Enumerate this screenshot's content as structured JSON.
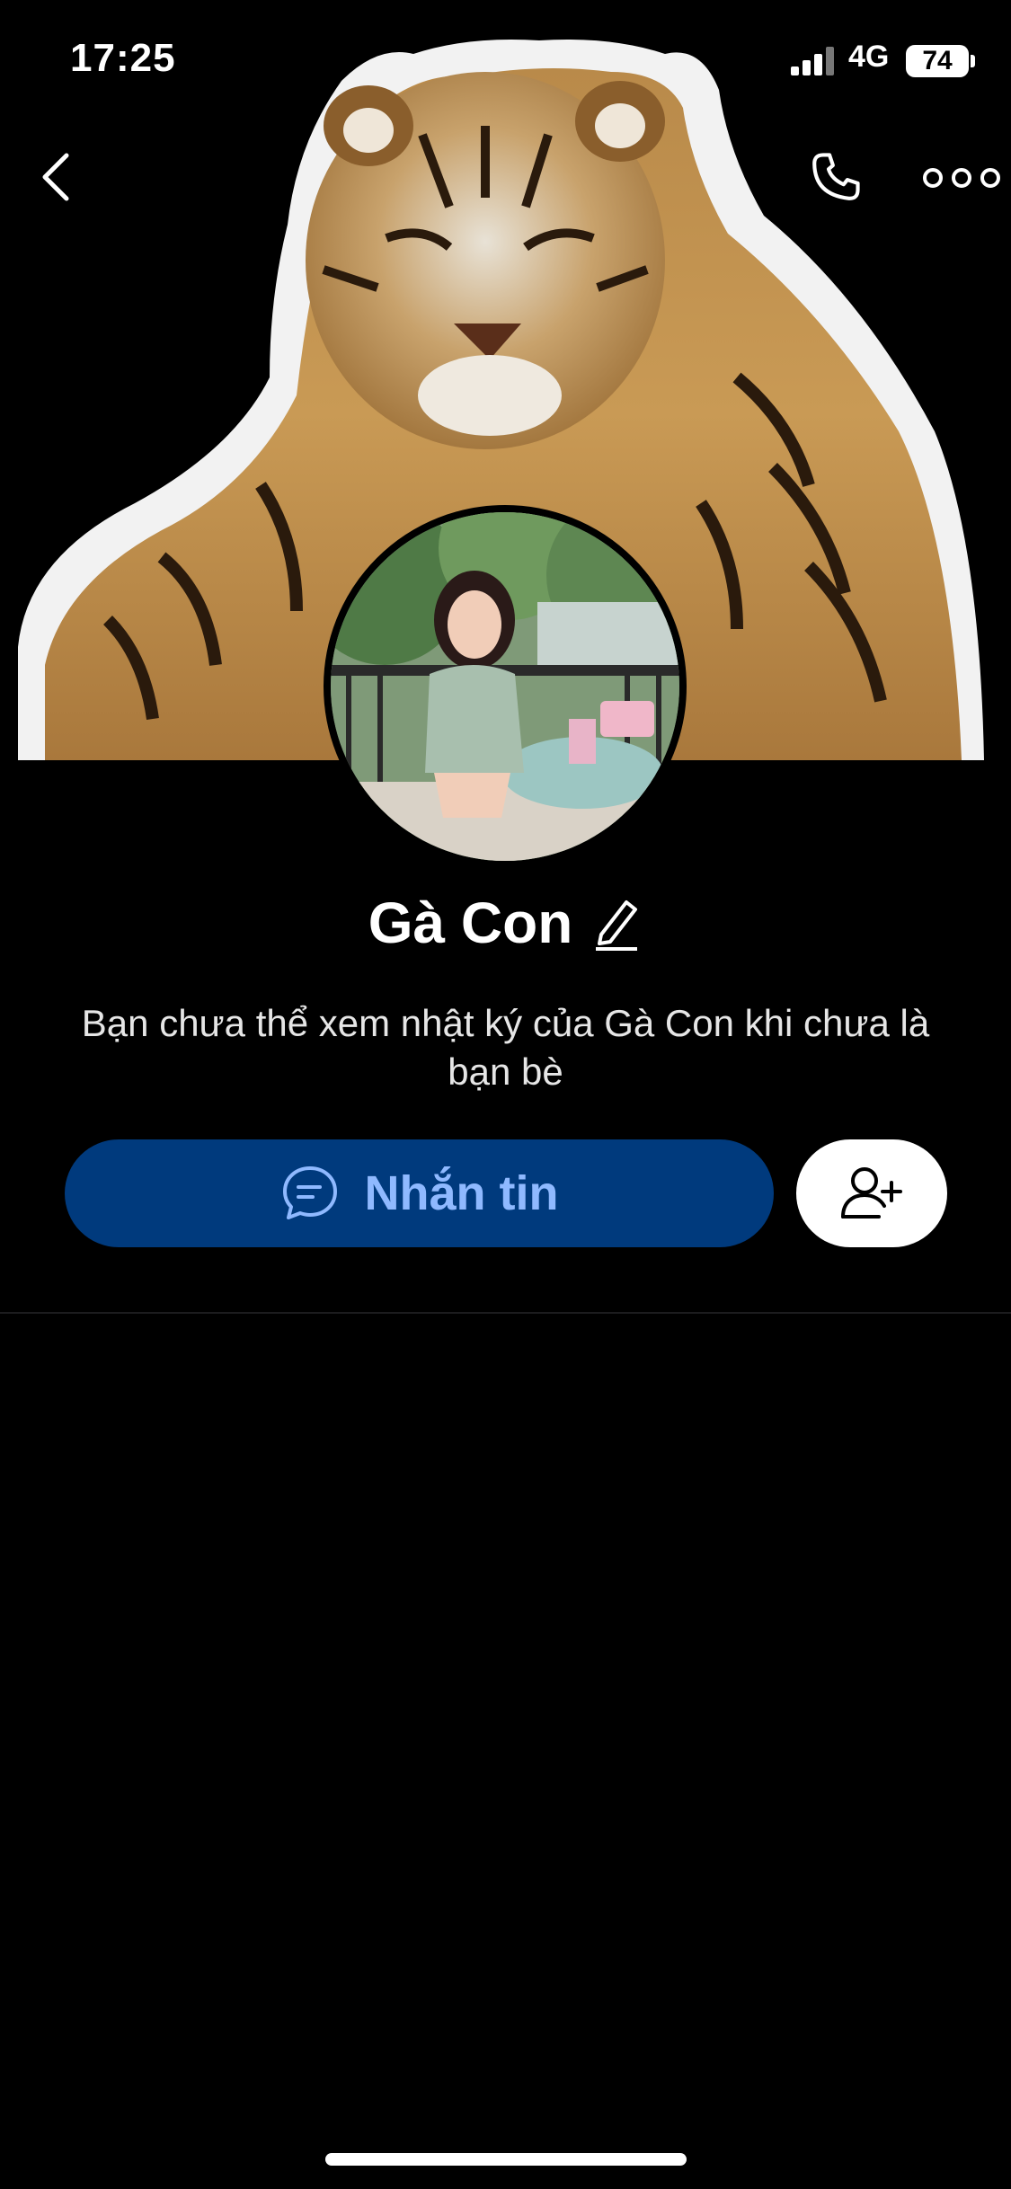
{
  "status_bar": {
    "time": "17:25",
    "network": "4G",
    "battery": "74"
  },
  "nav": {
    "back_icon": "chevron-left-icon",
    "call_icon": "phone-icon",
    "more_icon": "more-horizontal-icon"
  },
  "cover": {
    "description_icon": "tiger-photo"
  },
  "profile": {
    "name": "Gà Con",
    "edit_icon": "pencil-icon",
    "notice": "Bạn chưa thể xem nhật ký của Gà Con khi chưa là bạn bè"
  },
  "actions": {
    "message_label": "Nhắn tin",
    "message_icon": "chat-bubble-icon",
    "add_friend_icon": "add-user-icon"
  },
  "colors": {
    "background": "#000000",
    "message_button_bg": "#003a7d",
    "message_button_text": "#8fb9ff",
    "add_friend_bg": "#ffffff"
  }
}
